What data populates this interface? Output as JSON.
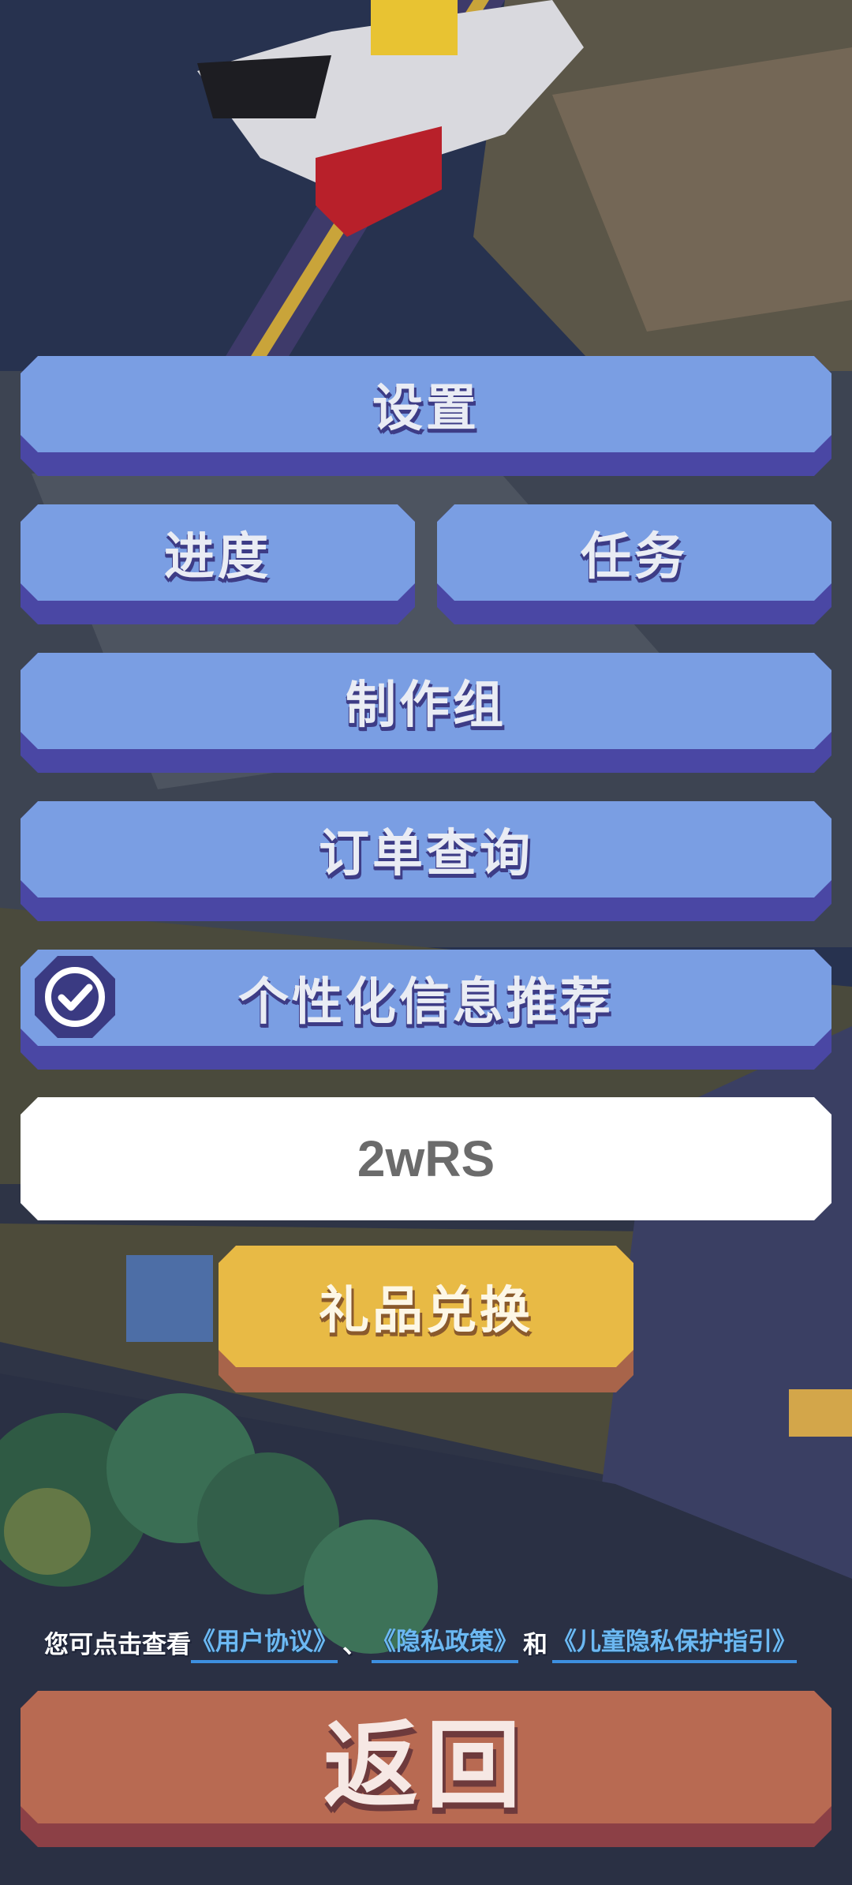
{
  "menu": {
    "settings_label": "设置",
    "progress_label": "进度",
    "tasks_label": "任务",
    "credits_label": "制作组",
    "orders_label": "订单查询",
    "personalized_label": "个性化信息推荐",
    "personalized_checked": true
  },
  "redeem": {
    "code_value": "2wRS",
    "button_label": "礼品兑换"
  },
  "legal": {
    "prefix": "您可点击查看",
    "user_agreement": "《用户协议》",
    "separator": "、",
    "privacy_policy": "《隐私政策》",
    "and": "和",
    "child_privacy": "《儿童隐私保护指引》"
  },
  "back_label": "返回",
  "colors": {
    "button_face": "#7a9ee3",
    "button_shadow": "#4a47a4",
    "redeem_face": "#e8ba45",
    "back_face": "#b86a52",
    "link": "#6cb8f2"
  }
}
